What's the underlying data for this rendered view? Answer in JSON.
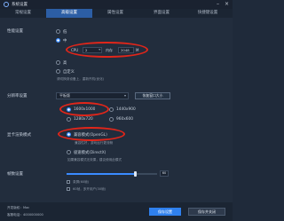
{
  "window": {
    "title": "系统设置",
    "minimize_glyph": "–",
    "close_glyph": "×"
  },
  "tabs": [
    {
      "label": "常规设置",
      "active": false
    },
    {
      "label": "高级设置",
      "active": true
    },
    {
      "label": "属性设置",
      "active": false
    },
    {
      "label": "界面设置",
      "active": false
    },
    {
      "label": "快捷键设置",
      "active": false
    }
  ],
  "performance": {
    "label": "性能设置",
    "options": [
      {
        "label": "低",
        "selected": false
      },
      {
        "label": "中",
        "selected": true
      },
      {
        "label": "高",
        "selected": false
      },
      {
        "label": "自定义",
        "selected": false
      }
    ],
    "cpu_label": "CPU",
    "cpu_value": "2",
    "memory_label": "内存",
    "memory_value": "2048",
    "memory_unit": "M",
    "hint": "请切换到设备上，重新开机(优化)"
  },
  "resolution": {
    "label": "分辨率设置",
    "preset_value": "平板版",
    "restore_button": "恢复窗口大小",
    "options": [
      {
        "label": "1600x1000",
        "selected": true
      },
      {
        "label": "1440x900",
        "selected": false
      },
      {
        "label": "1280x720",
        "selected": false
      },
      {
        "label": "960x600",
        "selected": false
      }
    ]
  },
  "render": {
    "label": "显卡渲染模式",
    "options": [
      {
        "label": "兼容模式(OpenGL)",
        "selected": true
      },
      {
        "label": "极速模式(DirectX)",
        "selected": false
      }
    ],
    "hint_1": "兼容性好，游戏运行更流畅",
    "hint_2": "如果兼容模式无效果，建议使用此模式"
  },
  "fps": {
    "label": "帧数设置",
    "value": "60",
    "level": 0.75,
    "check_1": "录屏(60帧)",
    "check_2": "60帧，多开用户(30帧)"
  },
  "footer": {
    "version_label": "开发版权：Mac",
    "contact_label": "客服电话：4000000000",
    "save_button": "保存设置",
    "save_close_button": "保存并关闭"
  },
  "colors": {
    "accent": "#2f80ed",
    "annotation": "#e0261a",
    "active_tab": "#2c5ea5"
  },
  "icons": {
    "app": "settings-icon",
    "close": "close-icon",
    "minimize": "minimize-icon"
  }
}
